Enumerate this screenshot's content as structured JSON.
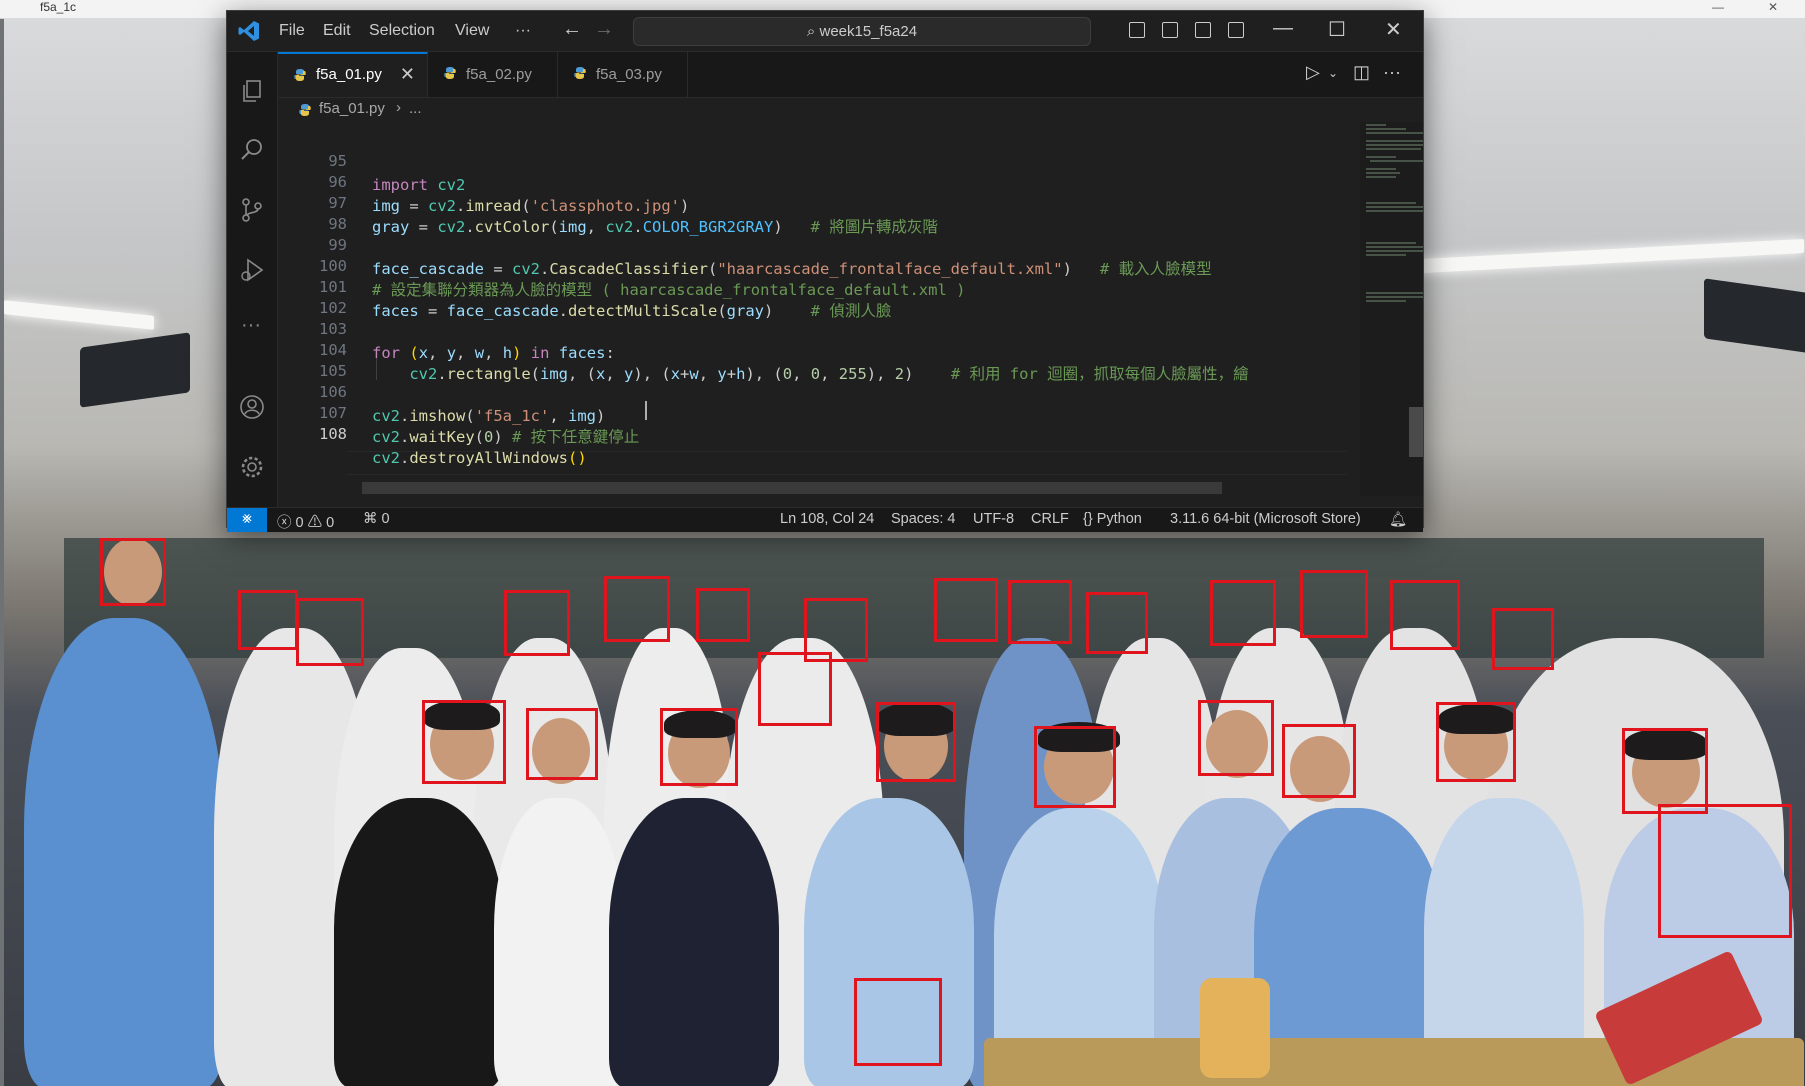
{
  "photo_window": {
    "title": "f5a_1c"
  },
  "vscode": {
    "menu": [
      "File",
      "Edit",
      "Selection",
      "View"
    ],
    "more_menu_label": "···",
    "search_text": "week15_f5a24",
    "tabs": [
      {
        "label": "f5a_01.py",
        "active": true
      },
      {
        "label": "f5a_02.py",
        "active": false
      },
      {
        "label": "f5a_03.py",
        "active": false
      }
    ],
    "breadcrumb": {
      "file": "f5a_01.py",
      "separator": "›",
      "rest": "..."
    },
    "code": {
      "line_numbers": [
        "95",
        "96",
        "97",
        "98",
        "99",
        "100",
        "101",
        "102",
        "103",
        "104",
        "105",
        "106",
        "107",
        "108"
      ],
      "lines": [
        "import cv2",
        "img = cv2.imread('classphoto.jpg')",
        "gray = cv2.cvtColor(img, cv2.COLOR_BGR2GRAY)   # 將圖片轉成灰階",
        "",
        "face_cascade = cv2.CascadeClassifier(\"haarcascade_frontalface_default.xml\")   # 載入人臉模型",
        "# 設定集聯分類器為人臉的模型 ( haarcascade_frontalface_default.xml )",
        "faces = face_cascade.detectMultiScale(gray)    # 偵測人臉",
        "",
        "for (x, y, w, h) in faces:",
        "    cv2.rectangle(img, (x, y), (x+w, y+h), (0, 0, 255), 2)    # 利用 for 迴圈，抓取每個人臉屬性，繪",
        "",
        "cv2.imshow('f5a_1c', img)",
        "cv2.waitKey(0) # 按下任意鍵停止",
        "cv2.destroyAllWindows()"
      ]
    },
    "status": {
      "errors": "0",
      "warnings": "0",
      "ports": "0",
      "position": "Ln 108, Col 24",
      "spaces": "Spaces: 4",
      "encoding": "UTF-8",
      "eol": "CRLF",
      "language": "Python",
      "interpreter": "3.11.6 64-bit (Microsoft Store)"
    },
    "accent": "#0078d4"
  },
  "detection_box_color": "#e0141d"
}
